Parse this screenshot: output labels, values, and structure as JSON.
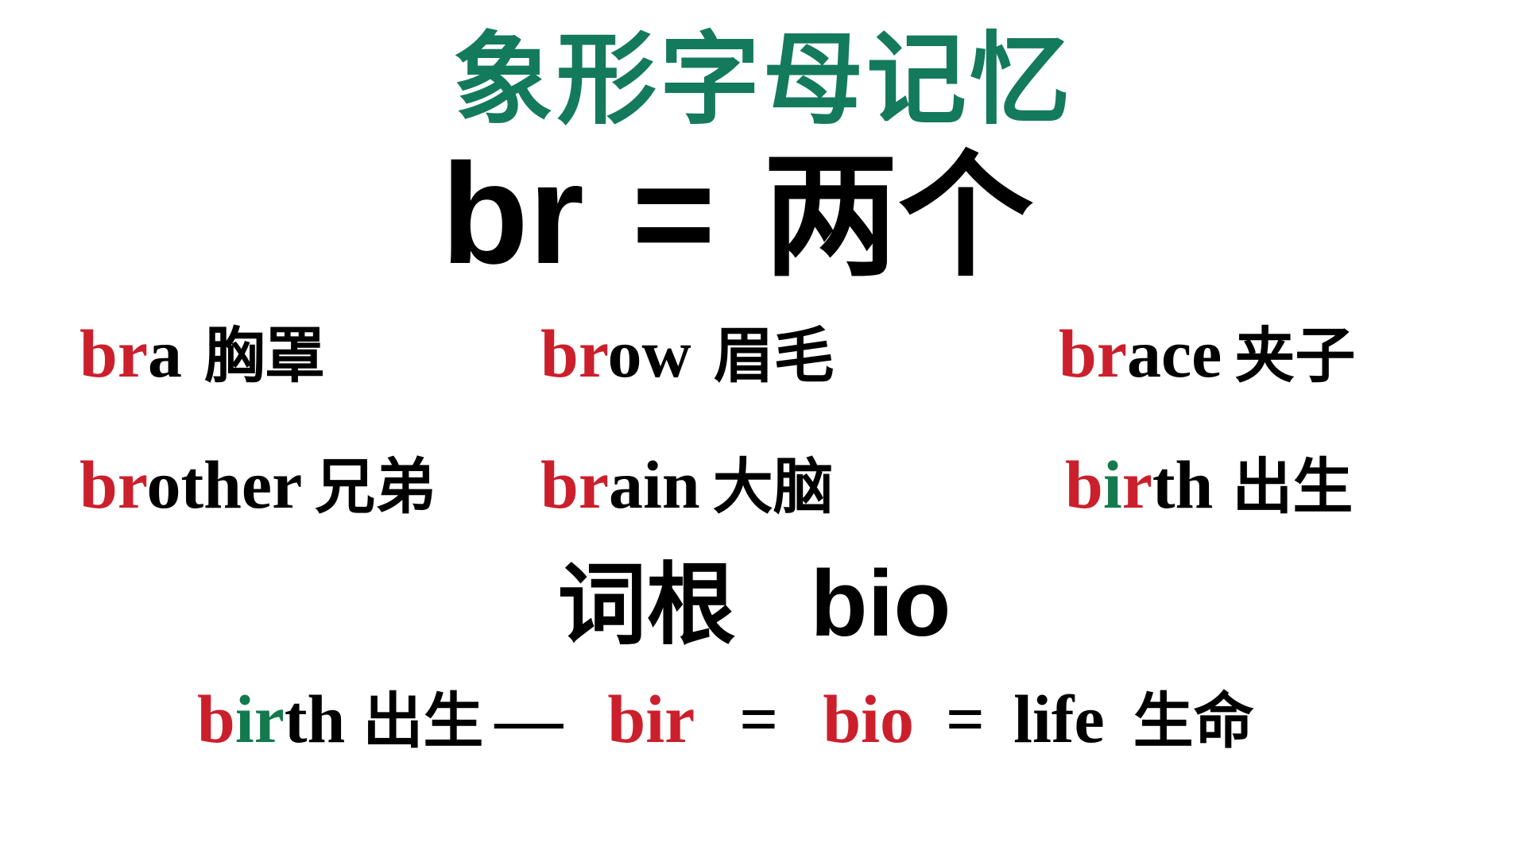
{
  "title": "象形字母记忆",
  "headline": {
    "prefix": "br",
    "equals": "=",
    "meaning": "两个"
  },
  "words": [
    {
      "red": "br",
      "green": "",
      "rest": "a",
      "meaning": "胸罩"
    },
    {
      "red": "br",
      "green": "",
      "rest": "ow",
      "meaning": "眉毛"
    },
    {
      "red": "br",
      "green": "",
      "rest": "ace",
      "meaning": "夹子"
    },
    {
      "red": "br",
      "green": "",
      "rest": "other",
      "meaning": "兄弟"
    },
    {
      "red": "br",
      "green": "",
      "rest": "ain",
      "meaning": "大脑"
    },
    {
      "red": "b",
      "green": "i",
      "red2": "r",
      "rest": "th",
      "meaning": "出生"
    }
  ],
  "root": {
    "label": "词根",
    "value": "bio"
  },
  "equation": {
    "word_red": "b",
    "word_green": "ir",
    "word_rest": "th",
    "word_meaning": "出生",
    "dash": "—",
    "bir": "bir",
    "eq1": "=",
    "bio": "bio",
    "eq2": "=",
    "life": "life",
    "life_meaning": "生命"
  },
  "colors": {
    "title": "#147a5c",
    "accent_red": "#cc1f2c",
    "accent_green": "#137a4f",
    "text": "#000000",
    "background": "#ffffff"
  }
}
